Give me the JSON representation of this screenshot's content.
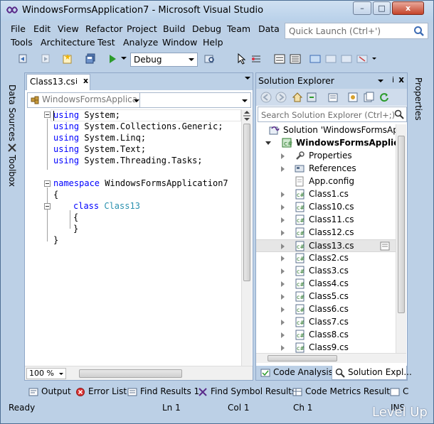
{
  "window": {
    "title": "WindowsFormsApplication7 - Microsoft Visual Studio",
    "minimize_glyph": "–",
    "maximize_glyph": "□",
    "close_glyph": "x"
  },
  "menu": {
    "row1": [
      "File",
      "Edit",
      "View",
      "Refactor",
      "Project",
      "Build",
      "Debug",
      "Team",
      "Data"
    ],
    "row2": [
      "Tools",
      "Architecture",
      "Test",
      "Analyze",
      "Window",
      "Help"
    ]
  },
  "quick_launch": {
    "placeholder": "Quick Launch (Ctrl+')"
  },
  "toolbar": {
    "configuration": "Debug"
  },
  "left_tabs": {
    "data_sources": "Data Sources",
    "toolbox": "Toolbox"
  },
  "editor": {
    "tab_label": "Class13.cs",
    "tab_pin": "ⅰ",
    "tab_close": "x",
    "nav_type": "WindowsFormsApplica",
    "zoom": "100 %",
    "code": [
      {
        "kw": "using",
        "rest": " System;"
      },
      {
        "kw": "using",
        "rest": " System.Collections.Generic;"
      },
      {
        "kw": "using",
        "rest": " System.Linq;"
      },
      {
        "kw": "using",
        "rest": " System.Text;"
      },
      {
        "kw": "using",
        "rest": " System.Threading.Tasks;"
      },
      {
        "kw": "namespace",
        "rest": " WindowsFormsApplication7"
      },
      {
        "text": "{"
      },
      {
        "kw": "class",
        "type": "Class13"
      },
      {
        "text": "{"
      },
      {
        "text": "}"
      },
      {
        "text": "}"
      }
    ]
  },
  "solution_explorer": {
    "title": "Solution Explorer",
    "pin": "ⅰ",
    "close": "x",
    "search_placeholder": "Search Solution Explorer (Ctrl+;)",
    "tree": [
      {
        "label": "Solution 'WindowsFormsApp",
        "kind": "solution"
      },
      {
        "label": "WindowsFormsApplicatio",
        "kind": "project",
        "bold": true
      },
      {
        "label": "Properties",
        "kind": "properties"
      },
      {
        "label": "References",
        "kind": "references"
      },
      {
        "label": "App.config",
        "kind": "config"
      },
      {
        "label": "Class1.cs",
        "kind": "cs"
      },
      {
        "label": "Class10.cs",
        "kind": "cs"
      },
      {
        "label": "Class11.cs",
        "kind": "cs"
      },
      {
        "label": "Class12.cs",
        "kind": "cs"
      },
      {
        "label": "Class13.cs",
        "kind": "cs",
        "selected": true
      },
      {
        "label": "Class2.cs",
        "kind": "cs"
      },
      {
        "label": "Class3.cs",
        "kind": "cs"
      },
      {
        "label": "Class4.cs",
        "kind": "cs"
      },
      {
        "label": "Class5.cs",
        "kind": "cs"
      },
      {
        "label": "Class6.cs",
        "kind": "cs"
      },
      {
        "label": "Class7.cs",
        "kind": "cs"
      },
      {
        "label": "Class8.cs",
        "kind": "cs"
      },
      {
        "label": "Class9.cs",
        "kind": "cs"
      }
    ],
    "bottom_tabs": [
      "Code Analysis",
      "Solution Expl..."
    ]
  },
  "right_tabs": {
    "properties": "Properties"
  },
  "bottom_tool_tabs": [
    "Output",
    "Error List",
    "Find Results 1",
    "Find Symbol Results",
    "Code Metrics Results",
    "C"
  ],
  "status": {
    "ready": "Ready",
    "ln": "Ln 1",
    "col": "Col 1",
    "ch": "Ch 1",
    "ins": "INS"
  },
  "watermark": "Level Up",
  "colors": {
    "chrome": "#bcd0e6",
    "keyword": "#0000ff",
    "type": "#2b91af",
    "accent_green": "#2c9b2c"
  }
}
